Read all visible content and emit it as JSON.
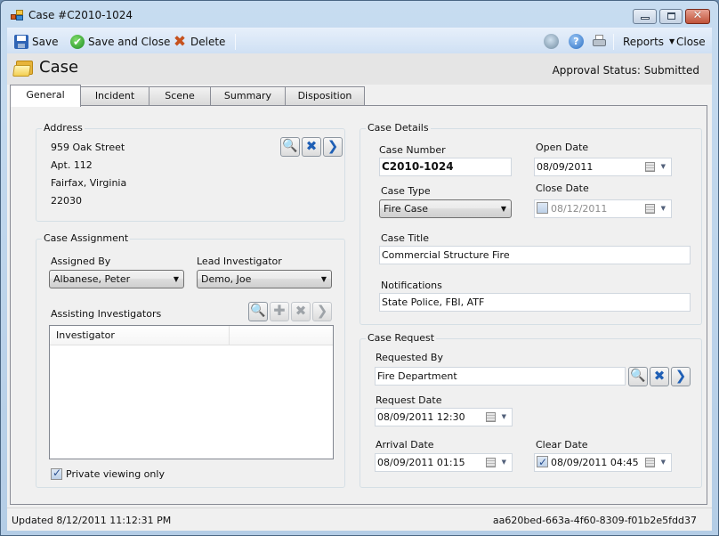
{
  "window": {
    "title": "Case #C2010-1024",
    "controls": {
      "minimize": "minimize",
      "maximize": "maximize",
      "close": "close"
    }
  },
  "toolbar": {
    "save_label": "Save",
    "save_close_label": "Save and Close",
    "delete_label": "Delete",
    "reports_label": "Reports",
    "close_label": "Close",
    "icons": [
      "save-icon",
      "check-icon",
      "delete-icon",
      "plugin-icon",
      "help-icon",
      "print-icon"
    ]
  },
  "header": {
    "title": "Case",
    "approval_status": "Approval Status: Submitted"
  },
  "tabs": [
    {
      "label": "General",
      "active": true
    },
    {
      "label": "Incident",
      "active": false
    },
    {
      "label": "Scene",
      "active": false
    },
    {
      "label": "Summary",
      "active": false
    },
    {
      "label": "Disposition",
      "active": false
    }
  ],
  "address": {
    "title": "Address",
    "lines": [
      "959 Oak Street",
      "Apt. 112",
      "Fairfax, Virginia",
      "22030"
    ]
  },
  "case_assignment": {
    "title": "Case Assignment",
    "assigned_by_label": "Assigned By",
    "assigned_by_value": "Albanese, Peter",
    "lead_investigator_label": "Lead Investigator",
    "lead_investigator_value": "Demo, Joe",
    "assisting_label": "Assisting Investigators",
    "grid_columns": [
      "Investigator",
      ""
    ],
    "grid_rows": [],
    "private_label": "Private viewing only",
    "private_checked": true
  },
  "case_details": {
    "title": "Case Details",
    "case_number_label": "Case Number",
    "case_number_value": "C2010-1024",
    "open_date_label": "Open Date",
    "open_date_value": "08/09/2011",
    "case_type_label": "Case Type",
    "case_type_value": "Fire Case",
    "close_date_label": "Close Date",
    "close_date_value": "08/12/2011",
    "close_date_checked": false,
    "case_title_label": "Case Title",
    "case_title_value": "Commercial Structure Fire",
    "notifications_label": "Notifications",
    "notifications_value": "State Police, FBI, ATF"
  },
  "case_request": {
    "title": "Case Request",
    "requested_by_label": "Requested By",
    "requested_by_value": "Fire Department",
    "request_date_label": "Request Date",
    "request_date_value": "08/09/2011 12:30",
    "arrival_date_label": "Arrival Date",
    "arrival_date_value": "08/09/2011 01:15",
    "clear_date_label": "Clear Date",
    "clear_date_value": "08/09/2011 04:45",
    "clear_date_checked": true
  },
  "statusbar": {
    "updated": "Updated 8/12/2011 11:12:31 PM",
    "record_id": "aa620bed-663a-4f60-8309-f01b2e5fdd37"
  },
  "glyphs": {
    "check": "✔",
    "delete": "✖",
    "help": "?",
    "caret": "▼",
    "close_x": "✕",
    "search": "🔍",
    "x": "✖",
    "next": "❯",
    "plus": "✚"
  }
}
